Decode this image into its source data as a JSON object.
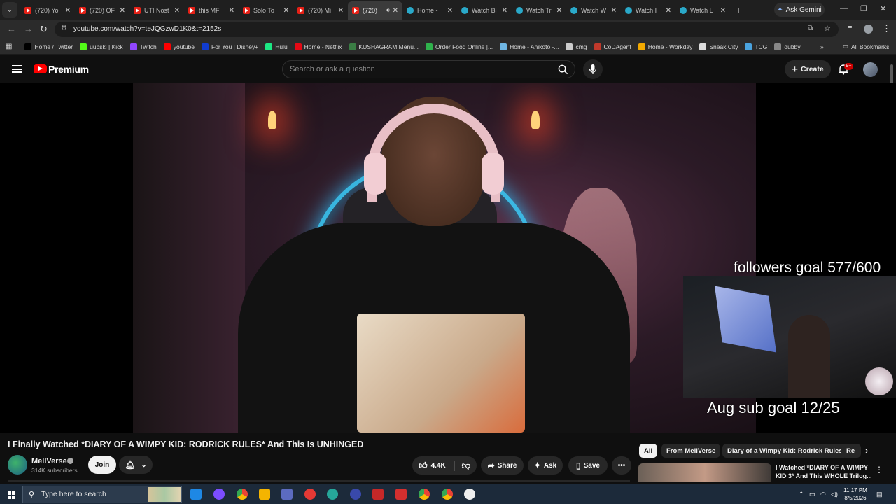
{
  "browser": {
    "tabs": [
      {
        "label": "(720) Yo",
        "fav": "youtube"
      },
      {
        "label": "(720) OF",
        "fav": "youtube"
      },
      {
        "label": "UTI Nost",
        "fav": "youtube"
      },
      {
        "label": "this MF",
        "fav": "youtube"
      },
      {
        "label": "Solo To",
        "fav": "youtube"
      },
      {
        "label": "(720) Mi",
        "fav": "youtube"
      },
      {
        "label": "(720)",
        "fav": "youtube",
        "active": true
      },
      {
        "label": "Home -",
        "fav": "generic"
      },
      {
        "label": "Watch Bl",
        "fav": "generic"
      },
      {
        "label": "Watch Tr",
        "fav": "generic"
      },
      {
        "label": "Watch W",
        "fav": "generic"
      },
      {
        "label": "Watch I",
        "fav": "generic"
      },
      {
        "label": "Watch L",
        "fav": "generic"
      }
    ],
    "gemini_label": "Ask Gemini",
    "url": "youtube.com/watch?v=teJQGzwD1K0&t=2152s",
    "bookmarks": [
      {
        "label": "Home / Twitter",
        "color": "#000000"
      },
      {
        "label": "uubski | Kick",
        "color": "#53fc18"
      },
      {
        "label": "Twitch",
        "color": "#9146ff"
      },
      {
        "label": "youtube",
        "color": "#ff0000"
      },
      {
        "label": "For You | Disney+",
        "color": "#113ccf"
      },
      {
        "label": "Hulu",
        "color": "#1ce783"
      },
      {
        "label": "Home - Netflix",
        "color": "#e50914"
      },
      {
        "label": "KUSHAGRAM Menu...",
        "color": "#3a7d44"
      },
      {
        "label": "Order Food Online |...",
        "color": "#2fb24c"
      },
      {
        "label": "Home - Anikoto -...",
        "color": "#6fb7e5"
      },
      {
        "label": "cmg",
        "color": "#cccccc"
      },
      {
        "label": "CoDAgent",
        "color": "#c0392b"
      },
      {
        "label": "Home - Workday",
        "color": "#f2a900"
      },
      {
        "label": "Sneak City",
        "color": "#dddddd"
      },
      {
        "label": "TCG",
        "color": "#4aa3df"
      },
      {
        "label": "dubby",
        "color": "#888888"
      }
    ],
    "all_bookmarks_label": "All Bookmarks"
  },
  "youtube": {
    "brand": "Premium",
    "search_placeholder": "Search or ask a question",
    "create_label": "Create",
    "notification_badge": "9+"
  },
  "video": {
    "overlay_top": "followers goal 577/600",
    "overlay_bottom": "Aug sub goal 12/25",
    "title": "I Finally Watched *DIARY OF A WIMPY KID: RODRICK RULES* And This Is UNHINGED",
    "channel_name": "MellVerse",
    "subscribers": "314K subscribers",
    "join_label": "Join",
    "like_count": "4.4K",
    "share_label": "Share",
    "ask_label": "Ask",
    "save_label": "Save"
  },
  "chips": [
    {
      "label": "All",
      "active": true
    },
    {
      "label": "From MellVerse"
    },
    {
      "label": "Diary of a Wimpy Kid: Rodrick Rules"
    },
    {
      "label": "Re"
    }
  ],
  "recommendation": {
    "title": "I Watched *DIARY OF A WIMPY KID 3* And This WHOLE Trilog..."
  },
  "taskbar": {
    "search_placeholder": "Type here to search",
    "time": "11:17 PM",
    "date": "8/5/2026"
  }
}
